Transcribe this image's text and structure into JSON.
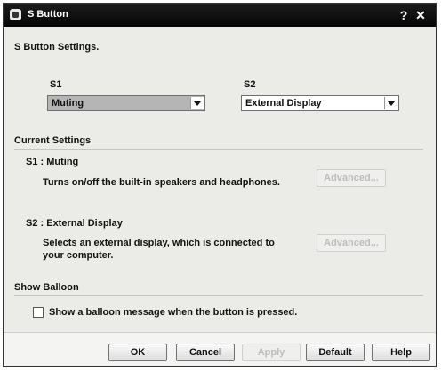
{
  "window": {
    "title": "S Button",
    "help_glyph": "?",
    "close_glyph": "✕"
  },
  "main": {
    "heading": "S Button Settings.",
    "s1_label": "S1",
    "s1_value": "Muting",
    "s2_label": "S2",
    "s2_value": "External Display"
  },
  "current": {
    "heading": "Current Settings",
    "s1_title": "S1 : Muting",
    "s1_desc": "Turns on/off the built-in speakers and headphones.",
    "s1_button": "Advanced...",
    "s2_title": "S2 : External Display",
    "s2_desc_line1": "Selects an external display, which is connected to",
    "s2_desc_line2": "your computer.",
    "s2_button": "Advanced..."
  },
  "balloon": {
    "heading": "Show Balloon",
    "checkbox_label": "Show a balloon message when the button is pressed.",
    "checked": false
  },
  "footer": {
    "ok": "OK",
    "cancel": "Cancel",
    "apply": "Apply",
    "default": "Default",
    "help": "Help"
  }
}
